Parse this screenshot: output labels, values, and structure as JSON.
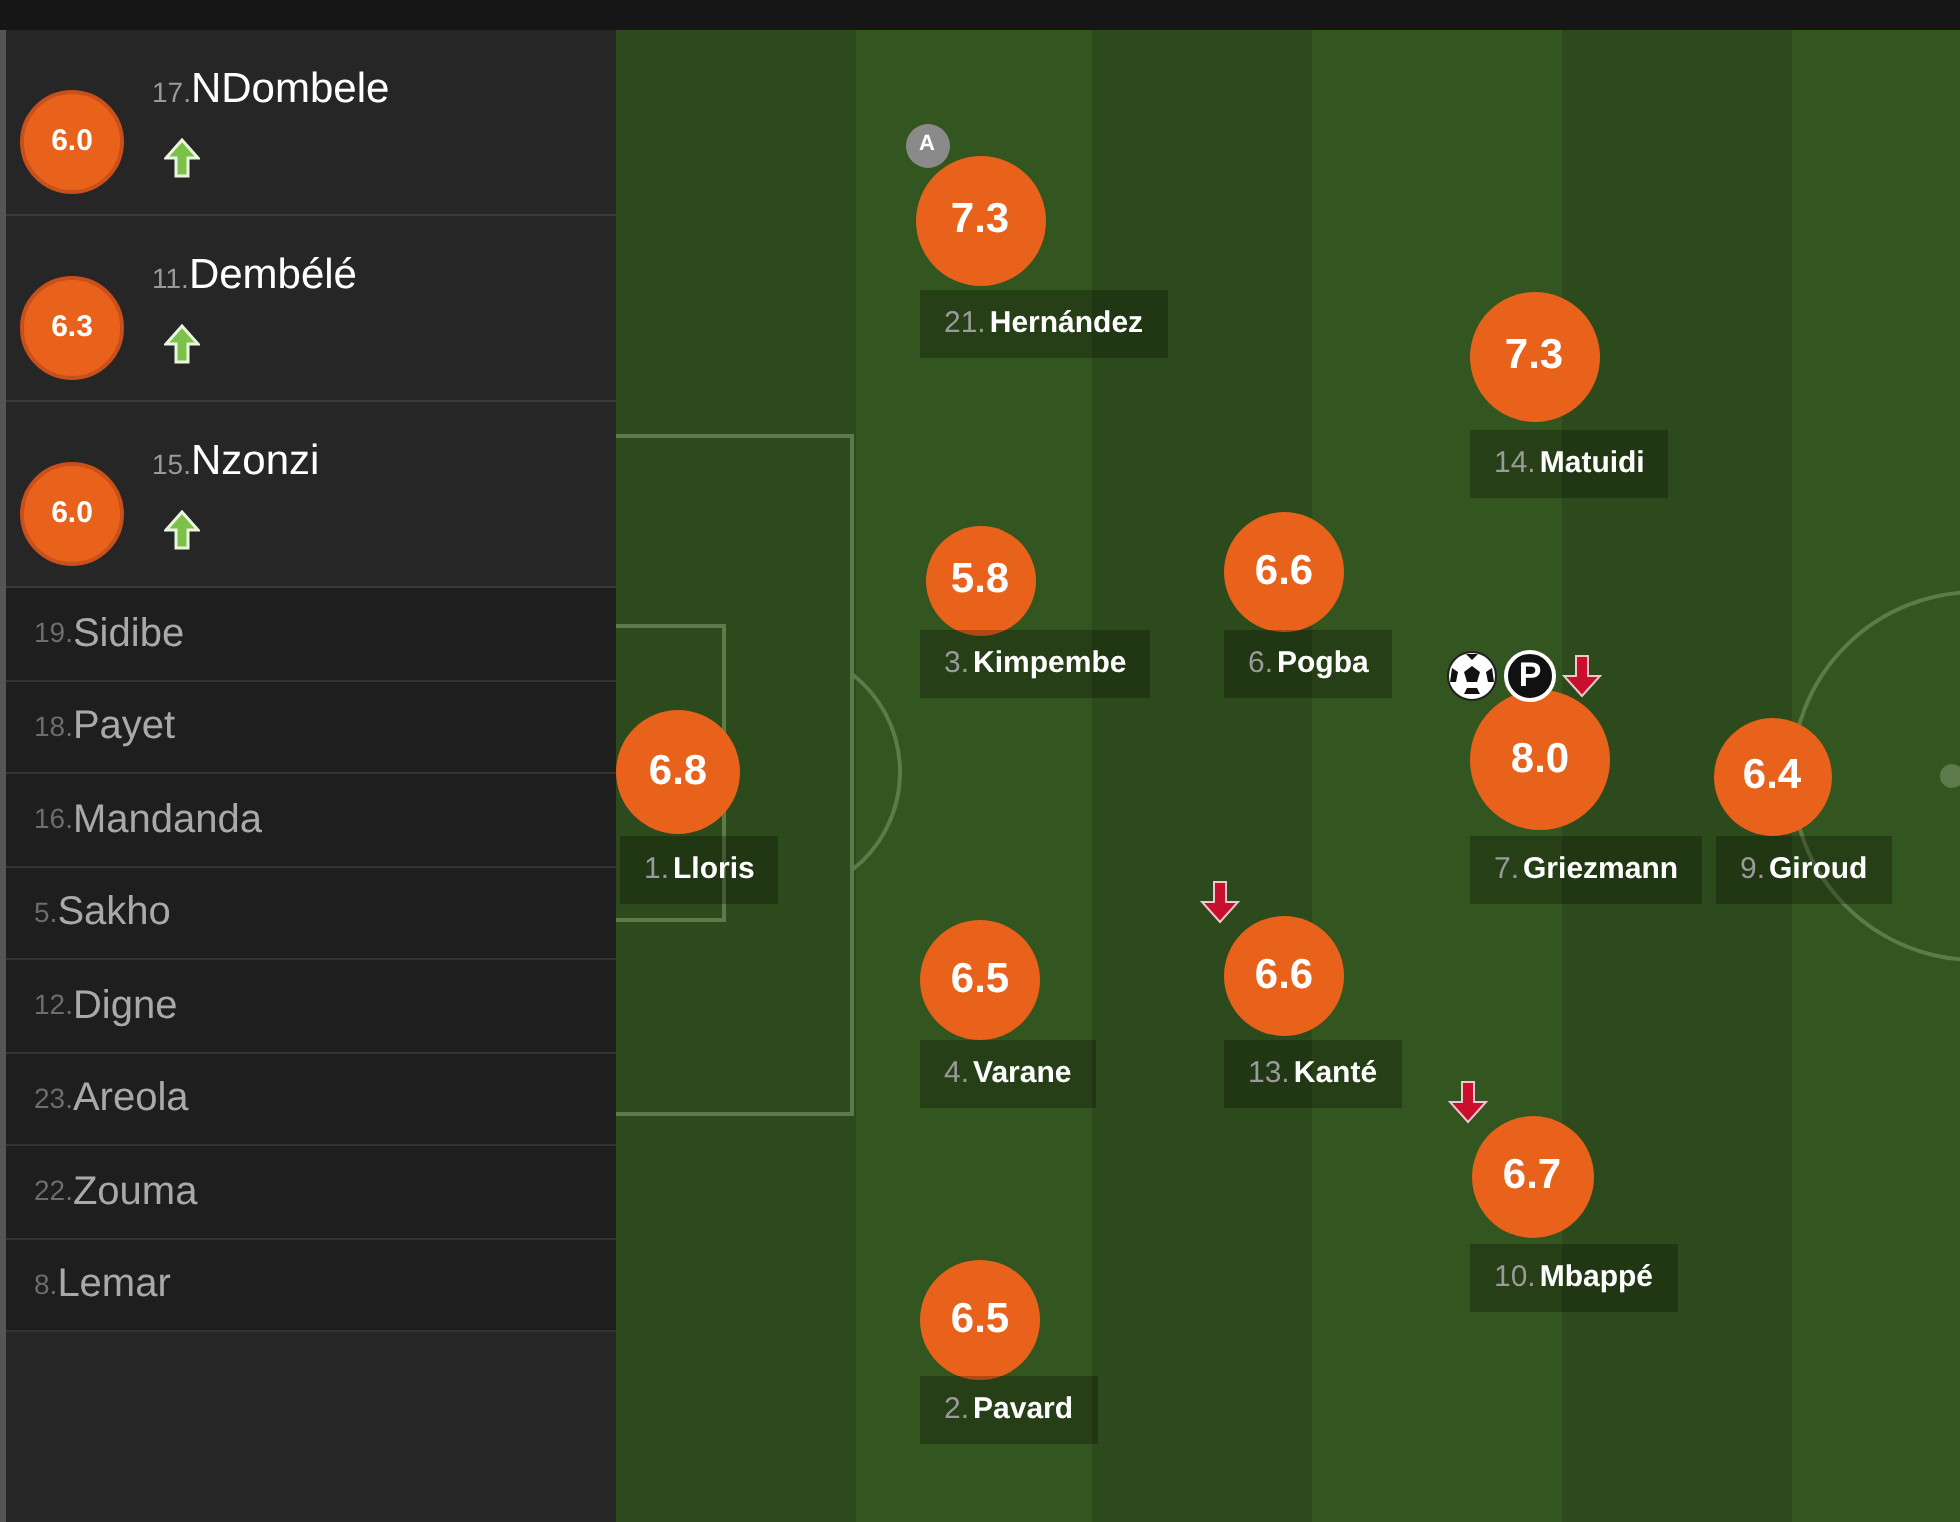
{
  "substitutes": [
    {
      "number": "17.",
      "name": "NDombele",
      "rating": "6.0",
      "subbed_on": true
    },
    {
      "number": "11.",
      "name": "Dembélé",
      "rating": "6.3",
      "subbed_on": true
    },
    {
      "number": "15.",
      "name": "Nzonzi",
      "rating": "6.0",
      "subbed_on": true
    }
  ],
  "bench": [
    {
      "number": "19.",
      "name": "Sidibe"
    },
    {
      "number": "18.",
      "name": "Payet"
    },
    {
      "number": "16.",
      "name": "Mandanda"
    },
    {
      "number": "5.",
      "name": "Sakho"
    },
    {
      "number": "12.",
      "name": "Digne"
    },
    {
      "number": "23.",
      "name": "Areola"
    },
    {
      "number": "22.",
      "name": "Zouma"
    },
    {
      "number": "8.",
      "name": "Lemar"
    }
  ],
  "pitch": {
    "players": [
      {
        "number": "21.",
        "name": "Hernández",
        "rating": "7.3",
        "captain_badge": "A",
        "goal": false,
        "subbed_off": false
      },
      {
        "number": "14.",
        "name": "Matuidi",
        "rating": "7.3",
        "goal": false,
        "subbed_off": false
      },
      {
        "number": "3.",
        "name": "Kimpembe",
        "rating": "5.8",
        "goal": false,
        "subbed_off": false
      },
      {
        "number": "6.",
        "name": "Pogba",
        "rating": "6.6",
        "goal": false,
        "subbed_off": false
      },
      {
        "number": "1.",
        "name": "Lloris",
        "rating": "6.8",
        "goal": false,
        "subbed_off": false
      },
      {
        "number": "7.",
        "name": "Griezmann",
        "rating": "8.0",
        "goal": true,
        "penalty_badge": "P",
        "subbed_off": true
      },
      {
        "number": "9.",
        "name": "Giroud",
        "rating": "6.4",
        "goal": false,
        "subbed_off": false
      },
      {
        "number": "4.",
        "name": "Varane",
        "rating": "6.5",
        "goal": false,
        "subbed_off": false
      },
      {
        "number": "13.",
        "name": "Kanté",
        "rating": "6.6",
        "goal": false,
        "subbed_off": true
      },
      {
        "number": "10.",
        "name": "Mbappé",
        "rating": "6.7",
        "goal": false,
        "subbed_off": true
      },
      {
        "number": "2.",
        "name": "Pavard",
        "rating": "6.5",
        "goal": false,
        "subbed_off": false
      }
    ]
  }
}
